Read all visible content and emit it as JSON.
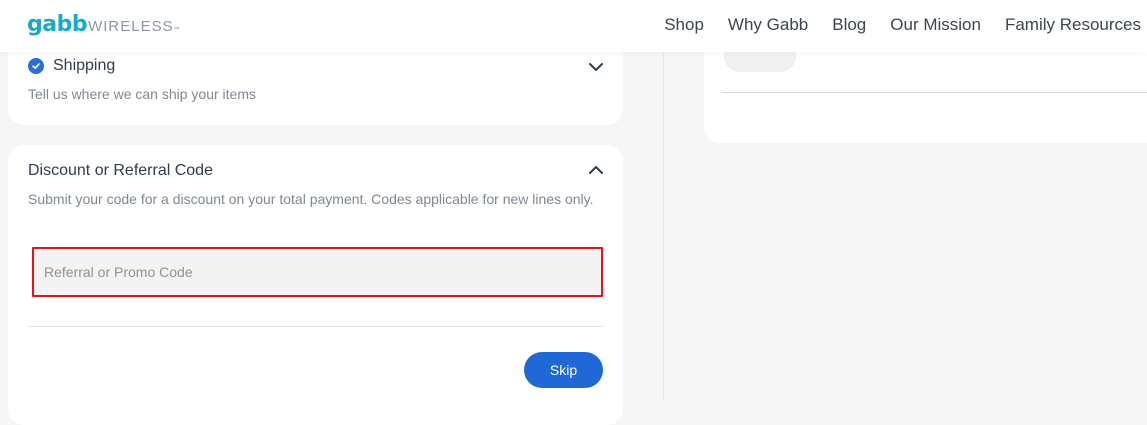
{
  "header": {
    "logo_main": "gabb",
    "logo_sub": "WIRELESS",
    "logo_tm": "™",
    "nav": [
      "Shop",
      "Why Gabb",
      "Blog",
      "Our Mission",
      "Family Resources"
    ]
  },
  "shipping": {
    "title": "Shipping",
    "description": "Tell us where we can ship your items",
    "completed": true,
    "icon": "chevron-down-icon"
  },
  "discount": {
    "title": "Discount or Referral Code",
    "description": "Submit your code for a discount on your total payment. Codes applicable for new lines only.",
    "input_placeholder": "Referral or Promo Code",
    "input_value": "",
    "skip_label": "Skip",
    "icon": "chevron-up-icon"
  },
  "colors": {
    "brand": "#1aa9c8",
    "primary_button": "#2068d6",
    "check": "#2a6fd6",
    "highlight_border": "#e8101a"
  }
}
